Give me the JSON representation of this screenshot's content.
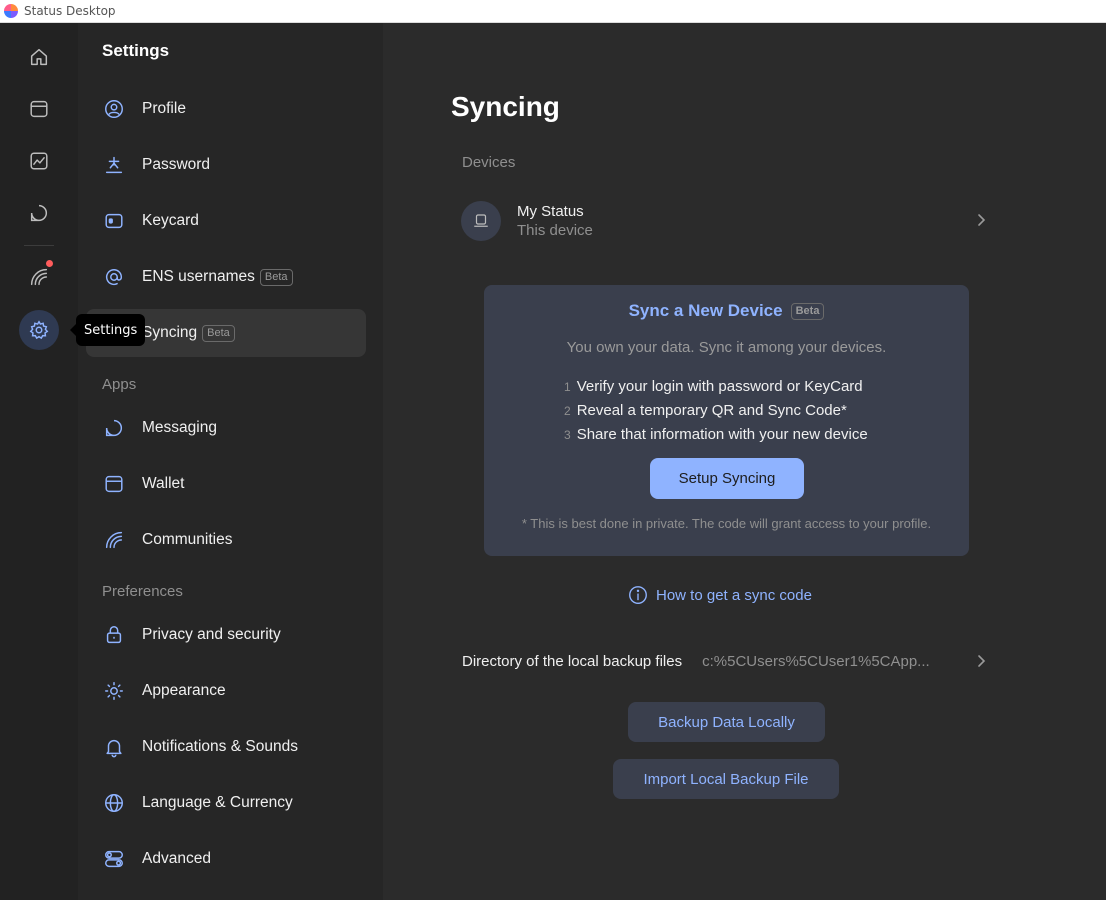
{
  "window": {
    "title": "Status Desktop"
  },
  "rail": {
    "tooltip": "Settings",
    "items": [
      {
        "name": "home",
        "icon": "home-icon"
      },
      {
        "name": "wallet",
        "icon": "wallet-icon"
      },
      {
        "name": "market",
        "icon": "chart-icon"
      },
      {
        "name": "messaging",
        "icon": "chat-icon"
      },
      {
        "name": "communities",
        "icon": "communities-icon",
        "notification": true
      },
      {
        "name": "settings",
        "icon": "gear-icon",
        "active": true
      }
    ]
  },
  "sidebar": {
    "title": "Settings",
    "items": [
      {
        "label": "Profile",
        "icon": "profile-icon"
      },
      {
        "label": "Password",
        "icon": "password-icon"
      },
      {
        "label": "Keycard",
        "icon": "keycard-icon"
      },
      {
        "label": "ENS usernames",
        "icon": "at-icon",
        "badge": "Beta"
      },
      {
        "label": "Syncing",
        "icon": "sync-icon",
        "badge": "Beta",
        "active": true
      }
    ],
    "apps_label": "Apps",
    "apps": [
      {
        "label": "Messaging",
        "icon": "chat-icon"
      },
      {
        "label": "Wallet",
        "icon": "wallet-icon"
      },
      {
        "label": "Communities",
        "icon": "communities-icon"
      }
    ],
    "preferences_label": "Preferences",
    "preferences": [
      {
        "label": "Privacy and security",
        "icon": "lock-icon"
      },
      {
        "label": "Appearance",
        "icon": "sun-icon"
      },
      {
        "label": "Notifications & Sounds",
        "icon": "bell-icon"
      },
      {
        "label": "Language & Currency",
        "icon": "globe-icon"
      },
      {
        "label": "Advanced",
        "icon": "toggles-icon"
      }
    ]
  },
  "main": {
    "title": "Syncing",
    "devices_label": "Devices",
    "device": {
      "name": "My Status",
      "subtitle": "This device"
    },
    "sync_card": {
      "title": "Sync a New Device",
      "badge": "Beta",
      "subtitle": "You own your data. Sync it among your devices.",
      "steps": [
        {
          "num": "1",
          "text": "Verify your login with password or KeyCard"
        },
        {
          "num": "2",
          "text": "Reveal a temporary QR and Sync Code*"
        },
        {
          "num": "3",
          "text": "Share that information with your new device"
        }
      ],
      "button": "Setup Syncing",
      "note": "* This is best done in private. The code will grant access to your profile."
    },
    "howto_link": "How to get a sync code",
    "backup_dir": {
      "label": "Directory of the local backup files",
      "value": "c:%5CUsers%5CUser1%5CApp..."
    },
    "backup_button": "Backup Data Locally",
    "import_button": "Import Local Backup File"
  },
  "colors": {
    "accent": "#8fb3ff",
    "notification": "#ff5c5c",
    "card": "#3a3f4d"
  }
}
